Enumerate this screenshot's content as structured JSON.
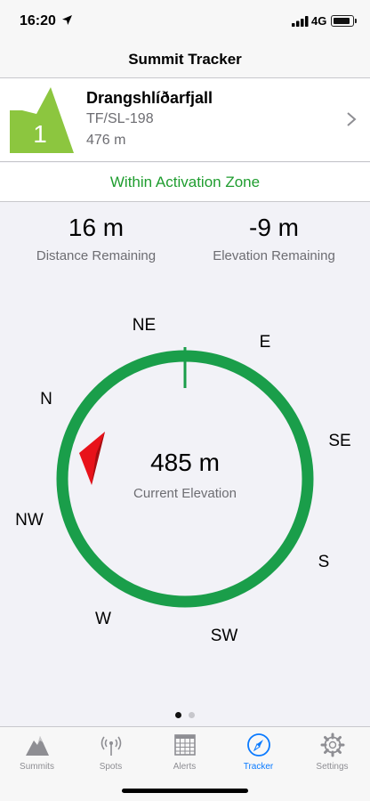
{
  "status_bar": {
    "time": "16:20",
    "network": "4G"
  },
  "nav": {
    "title": "Summit Tracker"
  },
  "summit": {
    "rank": "1",
    "name": "Drangshlíðarfjall",
    "reference": "TF/SL-198",
    "height": "476 m",
    "badge_color": "#8cc63f"
  },
  "zone": {
    "status": "Within Activation Zone",
    "color": "#1f9d2f"
  },
  "stats": {
    "distance": {
      "value": "16 m",
      "label": "Distance Remaining"
    },
    "elevation": {
      "value": "-9 m",
      "label": "Elevation Remaining"
    }
  },
  "compass": {
    "current_elevation": "485 m",
    "current_elevation_label": "Current Elevation",
    "ring_color": "#1a9e4a",
    "pointer_color": "#e8121a",
    "directions": [
      "N",
      "NE",
      "E",
      "SE",
      "S",
      "SW",
      "W",
      "NW"
    ]
  },
  "pager": {
    "pages": 2,
    "active": 0
  },
  "tabs": [
    {
      "label": "Summits",
      "icon": "mountain-icon",
      "active": false
    },
    {
      "label": "Spots",
      "icon": "antenna-icon",
      "active": false
    },
    {
      "label": "Alerts",
      "icon": "calendar-icon",
      "active": false
    },
    {
      "label": "Tracker",
      "icon": "compass-icon",
      "active": true
    },
    {
      "label": "Settings",
      "icon": "gear-icon",
      "active": false
    }
  ]
}
